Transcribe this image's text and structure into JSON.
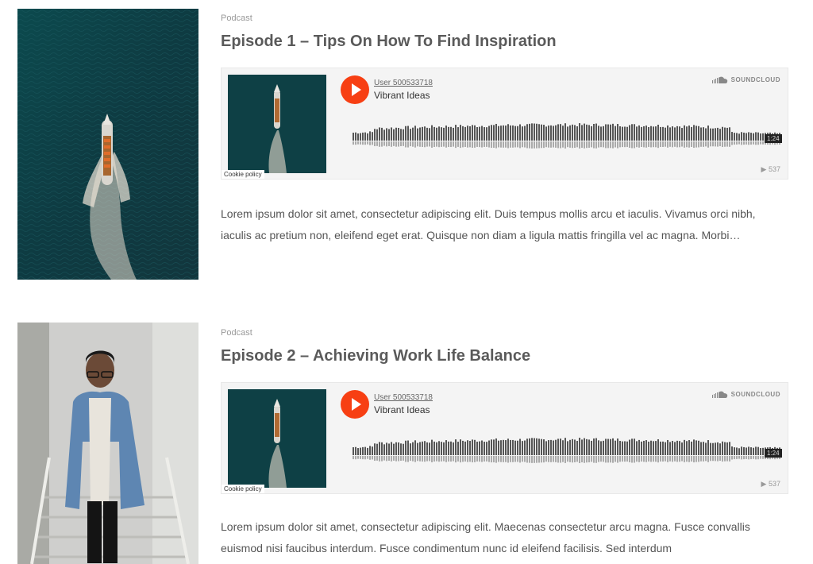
{
  "posts": [
    {
      "category": "Podcast",
      "title": "Episode 1 – Tips On How To Find Inspiration",
      "player": {
        "user": "User 500533718",
        "track": "Vibrant Ideas",
        "brand": "SOUNDCLOUD",
        "duration": "1:24",
        "plays": "▶ 537",
        "cookie": "Cookie policy"
      },
      "excerpt": "Lorem ipsum dolor sit amet, consectetur adipiscing elit. Duis tempus mollis arcu et iaculis. Vivamus orci nibh, iaculis ac pretium non, eleifend eget erat. Quisque non diam a ligula mattis fringilla vel ac magna. Morbi…"
    },
    {
      "category": "Podcast",
      "title": "Episode 2 – Achieving Work Life Balance",
      "player": {
        "user": "User 500533718",
        "track": "Vibrant Ideas",
        "brand": "SOUNDCLOUD",
        "duration": "1:24",
        "plays": "▶ 537",
        "cookie": "Cookie policy"
      },
      "excerpt": "Lorem ipsum dolor sit amet, consectetur adipiscing elit. Maecenas consectetur arcu magna. Fusce convallis euismod nisi faucibus interdum. Fusce condimentum nunc id eleifend facilisis. Sed interdum"
    }
  ],
  "colors": {
    "accent": "#f73f13",
    "waveform": "#555555",
    "ocean": "#0f3a3f"
  },
  "icons": {
    "play": "play-icon",
    "soundcloud": "soundcloud-logo-icon"
  }
}
